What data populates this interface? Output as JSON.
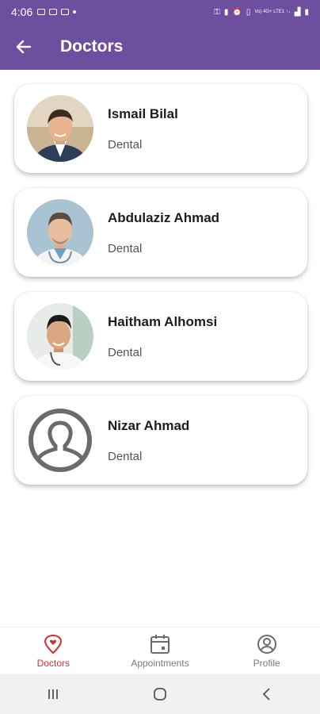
{
  "status_bar": {
    "time": "4:06",
    "network": "Vo) 4G+ LTE1 ↑↓"
  },
  "app_bar": {
    "title": "Doctors"
  },
  "doctors": [
    {
      "name": "Ismail Bilal",
      "specialty": "Dental"
    },
    {
      "name": "Abdulaziz Ahmad",
      "specialty": "Dental"
    },
    {
      "name": "Haitham Alhomsi",
      "specialty": "Dental"
    },
    {
      "name": "Nizar Ahmad",
      "specialty": "Dental"
    }
  ],
  "bottom_nav": {
    "items": [
      {
        "label": "Doctors",
        "icon": "location-heart-icon",
        "active": true
      },
      {
        "label": "Appointments",
        "icon": "calendar-icon",
        "active": false
      },
      {
        "label": "Profile",
        "icon": "user-circle-icon",
        "active": false
      }
    ]
  },
  "colors": {
    "primary": "#6e4e9e",
    "active": "#d32f2f",
    "inactive": "#7a7a7a"
  }
}
